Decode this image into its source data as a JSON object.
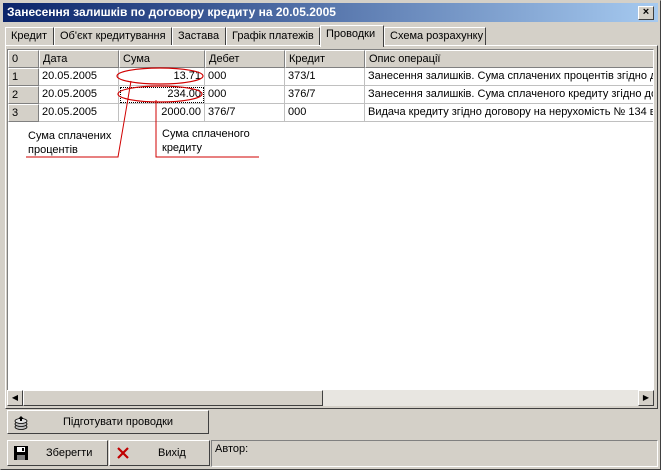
{
  "window": {
    "title": "Занесення залишків по договору кредиту на 20.05.2005",
    "close_label": "×"
  },
  "tabs": [
    {
      "label": "Кредит"
    },
    {
      "label": "Об'єкт кредитування"
    },
    {
      "label": "Застава"
    },
    {
      "label": "Графік платежів"
    },
    {
      "label": "Проводки"
    },
    {
      "label": "Схема розрахунку"
    }
  ],
  "active_tab": "Проводки",
  "table": {
    "headers": [
      "0",
      "Дата",
      "Сума",
      "Дебет",
      "Кредит",
      "Опис операції"
    ],
    "rows": [
      {
        "n": "1",
        "date": "20.05.2005",
        "sum": "13.71",
        "debit": "000",
        "credit": "373/1",
        "desc": "Занесення залишків. Сума сплачених процентів згідно д"
      },
      {
        "n": "2",
        "date": "20.05.2005",
        "sum": "234.00",
        "debit": "000",
        "credit": "376/7",
        "desc": "Занесення залишків. Сума сплаченого кредиту згідно до"
      },
      {
        "n": "3",
        "date": "20.05.2005",
        "sum": "2000.00",
        "debit": "376/7",
        "credit": "000",
        "desc": "Видача кредиту згідно договору  на нерухомість № 134 в"
      }
    ]
  },
  "annotations": {
    "paid_interest": "Сума сплачених\nпроцентів",
    "paid_credit": "Сума сплаченого\nкредиту"
  },
  "buttons": {
    "prepare": "Підготувати проводки",
    "save": "Зберегти",
    "exit": "Вихід"
  },
  "author_label": "Автор:",
  "colors": {
    "titlebar_start": "#0a246a",
    "titlebar_end": "#a6caf0",
    "annotation_red": "#d00000"
  }
}
